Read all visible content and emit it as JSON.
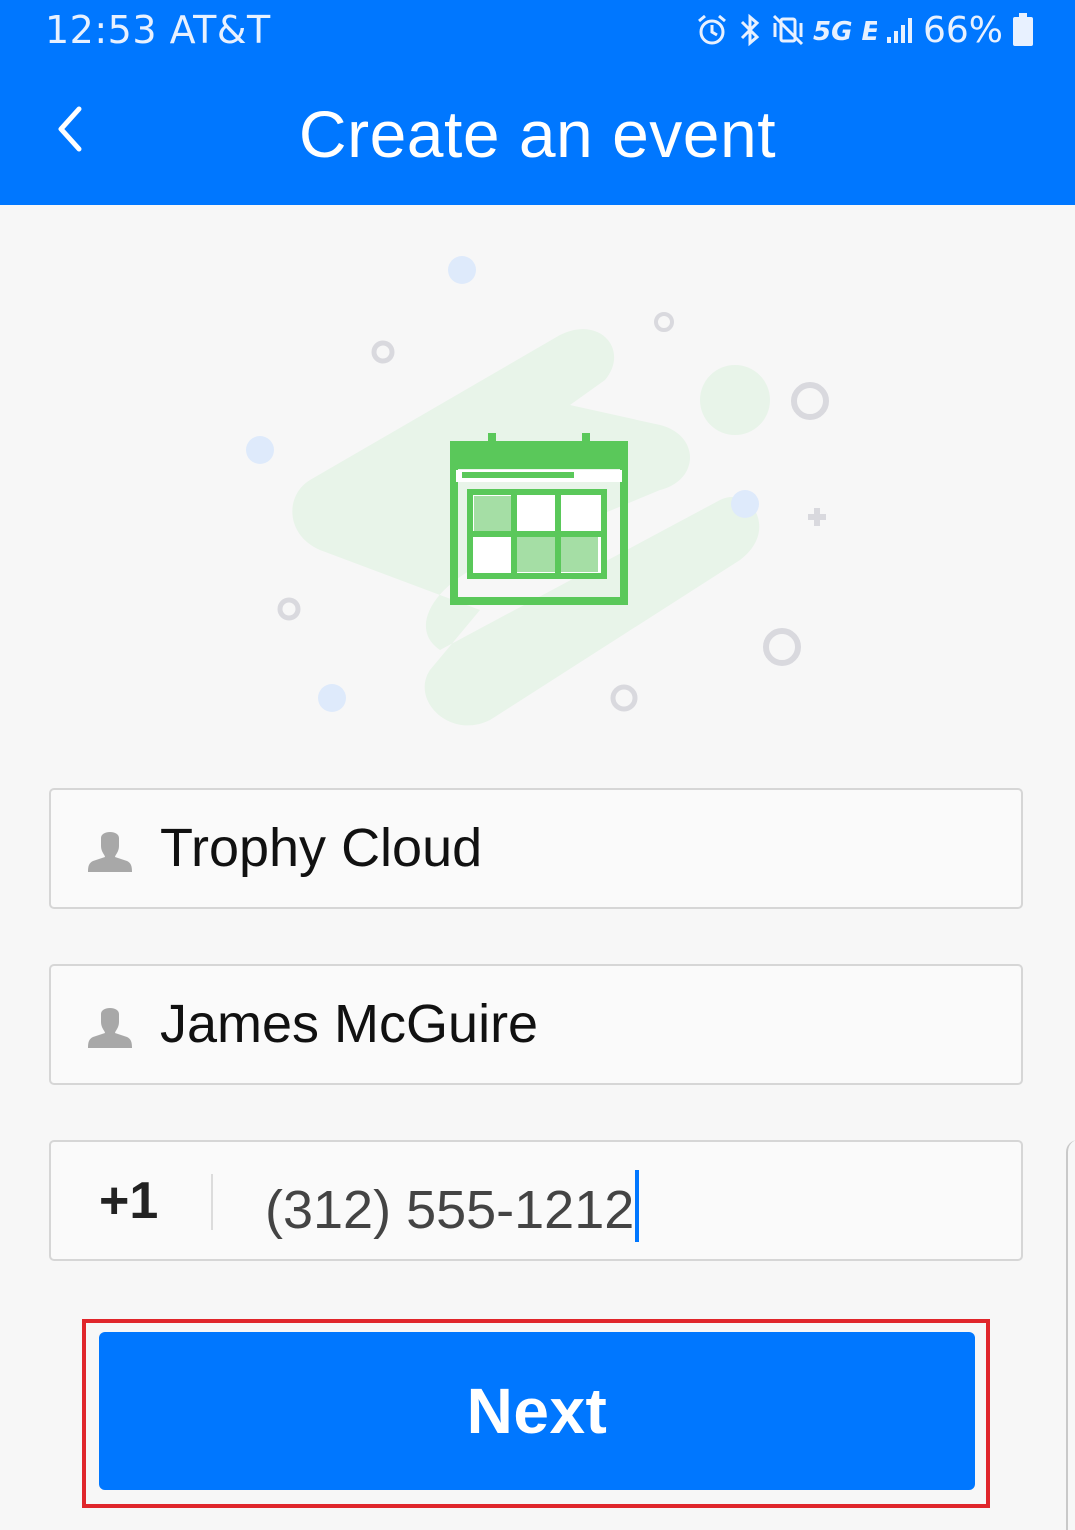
{
  "status_bar": {
    "time": "12:53",
    "carrier": "AT&T",
    "network": "5G E",
    "battery": "66%",
    "icons": [
      "alarm-icon",
      "bluetooth-icon",
      "vibrate-mute-icon",
      "network-5ge-icon",
      "signal-icon",
      "battery-icon"
    ]
  },
  "app_bar": {
    "title": "Create an event",
    "back_icon": "chevron-left-icon"
  },
  "illustration": {
    "icon": "calendar-icon"
  },
  "form": {
    "organization": {
      "value": "Trophy Cloud",
      "icon": "person-icon"
    },
    "name": {
      "value": "James McGuire",
      "icon": "person-icon"
    },
    "phone": {
      "country_code": "+1",
      "value": "(312) 555-1212"
    }
  },
  "next_button": {
    "label": "Next"
  },
  "colors": {
    "primary": "#0077ff",
    "highlight": "#e0262b",
    "calendar_green": "#5ac85a",
    "background": "#f7f7f7"
  }
}
